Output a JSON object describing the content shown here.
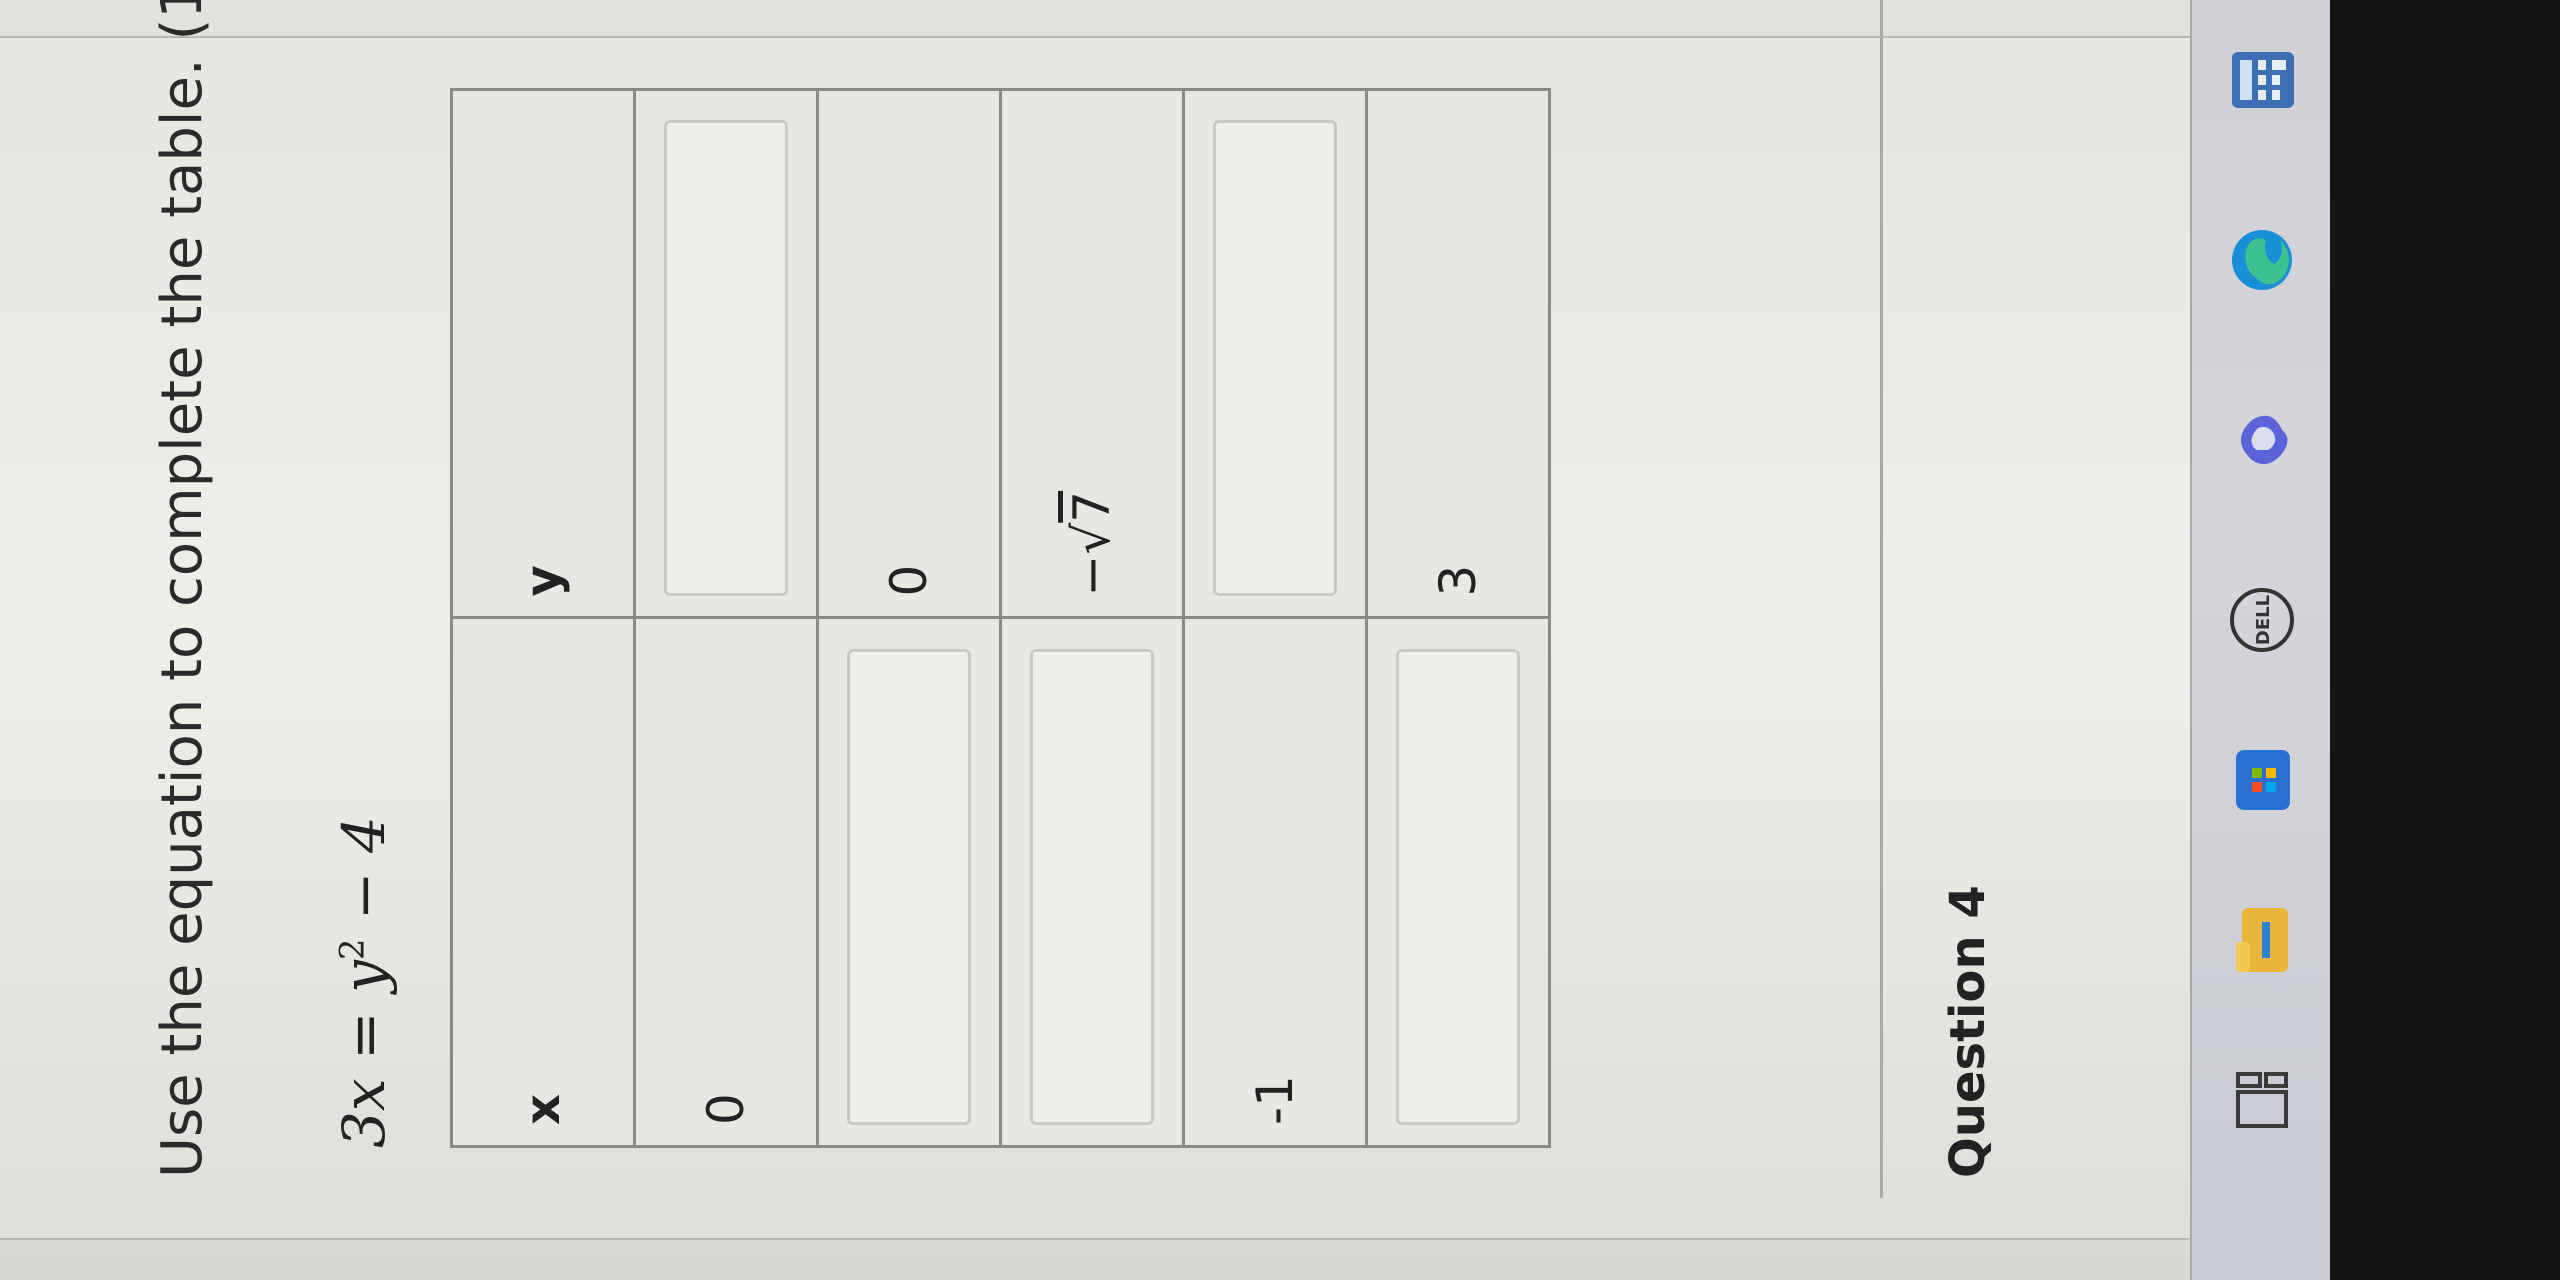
{
  "question": {
    "instruction": "Use the equation to complete the table. (1",
    "equation_lhs": "3x = y",
    "equation_exp": "2",
    "equation_rhs": " − 4"
  },
  "table": {
    "headers": [
      "x",
      "y"
    ],
    "rows": [
      {
        "x": "0",
        "y": ""
      },
      {
        "x": "",
        "y": "0"
      },
      {
        "x": "",
        "y_radical_sign": "−√",
        "y_radicand": "7"
      },
      {
        "x": "-1",
        "y": ""
      },
      {
        "x": "",
        "y": "3"
      }
    ]
  },
  "next_question": {
    "label": "Question 4"
  },
  "taskbar": {
    "icons": [
      "task-view-icon",
      "file-explorer-icon",
      "microsoft-store-icon",
      "dell-icon",
      "copilot-icon",
      "edge-icon",
      "calculator-icon"
    ],
    "dell_label": "DELL"
  }
}
